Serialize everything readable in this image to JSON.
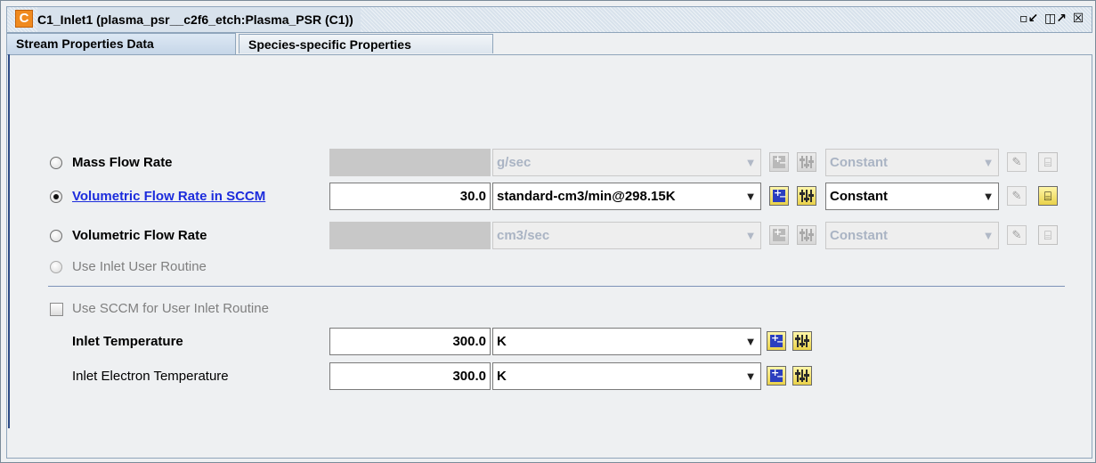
{
  "window": {
    "app_icon_letter": "C",
    "title": "C1_Inlet1  (plasma_psr__c2f6_etch:Plasma_PSR (C1))",
    "controls": {
      "restore": "▫↙",
      "maximize": "◫↗",
      "close": "☒"
    }
  },
  "tabs": [
    {
      "label": "Stream Properties Data",
      "active": true
    },
    {
      "label": "Species-specific Properties",
      "active": false
    }
  ],
  "flow_rows": [
    {
      "label": "Mass Flow Rate",
      "selected": false,
      "style": "bold",
      "value": "",
      "unit": "g/sec",
      "profile": "Constant",
      "enabled": false
    },
    {
      "label": "Volumetric Flow Rate in SCCM",
      "selected": true,
      "style": "link",
      "value": "30.0",
      "unit": "standard-cm3/min@298.15K",
      "profile": "Constant",
      "enabled": true
    },
    {
      "label": "Volumetric Flow Rate",
      "selected": false,
      "style": "bold",
      "value": "",
      "unit": "cm3/sec",
      "profile": "Constant",
      "enabled": false
    },
    {
      "label": "Use Inlet User Routine",
      "selected": false,
      "style": "disabled"
    }
  ],
  "checkbox": {
    "label": "Use SCCM for User Inlet Routine",
    "checked": false
  },
  "temperatures": [
    {
      "label": "Inlet Temperature",
      "bold": true,
      "value": "300.0",
      "unit": "K"
    },
    {
      "label": "Inlet Electron Temperature",
      "bold": false,
      "value": "300.0",
      "unit": "K"
    }
  ],
  "icons": {
    "unit_button": "plus-minus-icon",
    "parameter_button": "sliders-icon",
    "edit_button": "pencil-icon",
    "profile_button": "folder-graph-icon"
  },
  "colors": {
    "title_accent": "#f08a1e",
    "link": "#1c2cdc",
    "button_yellow": "#e9d24a",
    "separator": "#7d92b8"
  }
}
